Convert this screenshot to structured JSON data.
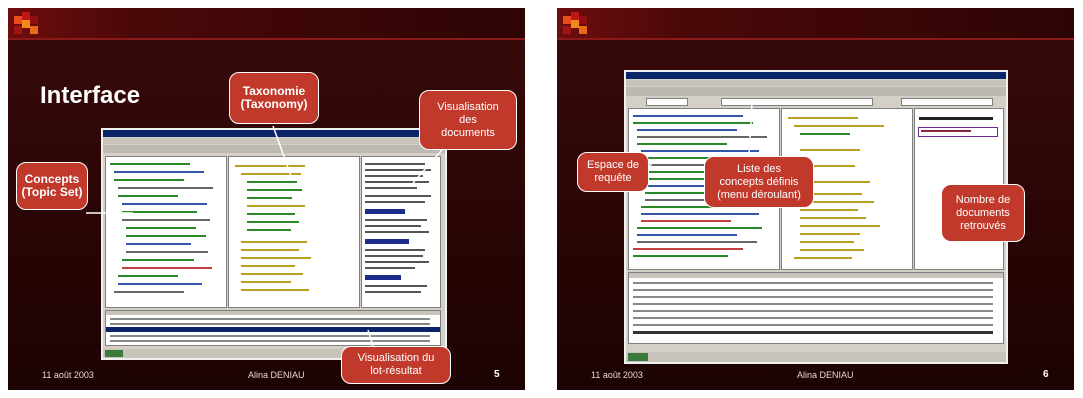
{
  "slides": [
    {
      "title": "Interface",
      "footer_date": "11 août 2003",
      "footer_author": "Alina DENIAU",
      "page_number": "5",
      "callouts": {
        "concepts": "Concepts\n(Topic Set)",
        "taxonomie": "Taxonomie\n(Taxonomy)",
        "visualisation_docs": "Visualisation\ndes\ndocuments",
        "visualisation_lot": "Visualisation du\nlot-résultat"
      }
    },
    {
      "footer_date": "11 août 2003",
      "footer_author": "Alina DENIAU",
      "page_number": "6",
      "callouts": {
        "espace": "Espace de\nrequête",
        "liste": "Liste des\nconcepts définis\n(menu déroulant)",
        "nombre": "Nombre de\ndocuments\nretrouvés"
      }
    }
  ]
}
